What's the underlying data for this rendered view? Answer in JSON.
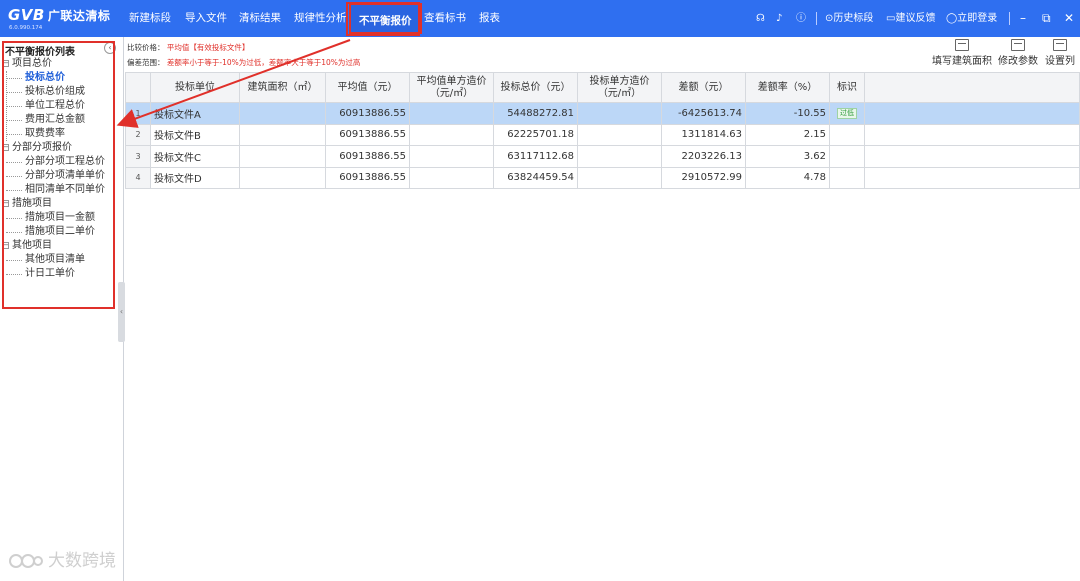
{
  "app": {
    "logo_text": "GVB",
    "logo_cn": "广联达清标",
    "version": "6.0.990.174"
  },
  "nav": [
    {
      "label": "新建标段"
    },
    {
      "label": "导入文件"
    },
    {
      "label": "清标结果"
    },
    {
      "label": "规律性分析"
    },
    {
      "label": "不平衡报价",
      "active": true
    },
    {
      "label": "查看标书"
    },
    {
      "label": "报表"
    }
  ],
  "topbar_right": {
    "history": "历史标段",
    "feedback": "建议反馈",
    "login": "立即登录"
  },
  "sidebar": {
    "title": "不平衡报价列表",
    "collapse_glyph": "‹",
    "groups": [
      {
        "label": "项目总价",
        "items": [
          "投标总价",
          "投标总价组成",
          "单位工程总价",
          "费用汇总金额",
          "取费费率"
        ]
      },
      {
        "label": "分部分项报价",
        "items": [
          "分部分项工程总价",
          "分部分项清单单价",
          "相同清单不同单价"
        ]
      },
      {
        "label": "措施项目",
        "items": [
          "措施项目一金额",
          "措施项目二单价"
        ]
      },
      {
        "label": "其他项目",
        "items": [
          "其他项目清单",
          "计日工单价"
        ]
      }
    ],
    "selected_item": "投标总价"
  },
  "info": {
    "compare_label": "比较价格：",
    "compare_value": "平均值【有效投标文件】",
    "range_label": "偏差范围：",
    "range_value": "差额率小于等于-10%为过低，差额率大于等于10%为过高"
  },
  "toolbar": {
    "fill_area": "填写建筑面积",
    "modify_params": "修改参数",
    "set_columns": "设置列"
  },
  "table": {
    "headers": [
      "",
      "投标单位",
      "建筑面积（㎡）",
      "平均值（元）",
      "平均值单方造价（元/㎡）",
      "投标总价（元）",
      "投标单方造价（元/㎡）",
      "差额（元）",
      "差额率（%）",
      "标识"
    ],
    "rows": [
      {
        "idx": "1",
        "unit": "投标文件A",
        "area": "",
        "avg": "60913886.55",
        "avg_unit": "",
        "total": "54488272.81",
        "unit_cost": "",
        "diff": "-6425613.74",
        "rate": "-10.55",
        "flag": "过低"
      },
      {
        "idx": "2",
        "unit": "投标文件B",
        "area": "",
        "avg": "60913886.55",
        "avg_unit": "",
        "total": "62225701.18",
        "unit_cost": "",
        "diff": "1311814.63",
        "rate": "2.15",
        "flag": ""
      },
      {
        "idx": "3",
        "unit": "投标文件C",
        "area": "",
        "avg": "60913886.55",
        "avg_unit": "",
        "total": "63117112.68",
        "unit_cost": "",
        "diff": "2203226.13",
        "rate": "3.62",
        "flag": ""
      },
      {
        "idx": "4",
        "unit": "投标文件D",
        "area": "",
        "avg": "60913886.55",
        "avg_unit": "",
        "total": "63824459.54",
        "unit_cost": "",
        "diff": "2910572.99",
        "rate": "4.78",
        "flag": ""
      }
    ],
    "selected_row": 0
  },
  "watermark": "大数跨境",
  "colors": {
    "topbar": "#2f6ff0",
    "highlight_red": "#e0302a",
    "selected_row": "#bcd7f7",
    "selected_tree": "#1f5ed8"
  }
}
